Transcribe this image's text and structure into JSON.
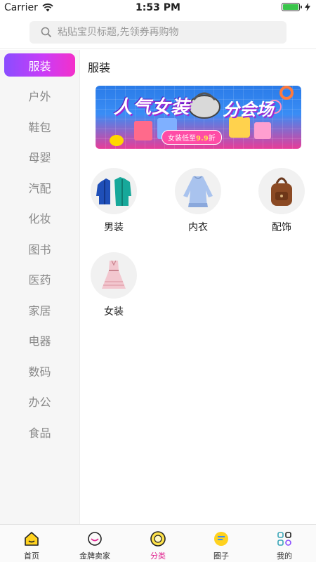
{
  "status": {
    "carrier": "Carrier",
    "time": "1:53 PM"
  },
  "search": {
    "placeholder": "粘贴宝贝标题,先领券再购物"
  },
  "sidebar": {
    "items": [
      {
        "label": "服装"
      },
      {
        "label": "户外"
      },
      {
        "label": "鞋包"
      },
      {
        "label": "母婴"
      },
      {
        "label": "汽配"
      },
      {
        "label": "化妆"
      },
      {
        "label": "图书"
      },
      {
        "label": "医药"
      },
      {
        "label": "家居"
      },
      {
        "label": "电器"
      },
      {
        "label": "数码"
      },
      {
        "label": "办公"
      },
      {
        "label": "食品"
      }
    ],
    "active_index": 0
  },
  "content": {
    "title": "服装",
    "banner": {
      "headline": "人气女装",
      "subheadline": "分会场",
      "tag_prefix": "女装低至",
      "tag_value": "9.9",
      "tag_suffix": "折"
    },
    "categories": [
      {
        "label": "男装"
      },
      {
        "label": "内衣"
      },
      {
        "label": "配饰"
      },
      {
        "label": "女装"
      }
    ]
  },
  "tabbar": {
    "items": [
      {
        "label": "首页"
      },
      {
        "label": "金牌卖家"
      },
      {
        "label": "分类"
      },
      {
        "label": "圈子"
      },
      {
        "label": "我的"
      }
    ],
    "active_index": 2
  },
  "colors": {
    "accent": "#e0228f",
    "pill_start": "#8a4dff",
    "pill_end": "#f430c9"
  }
}
